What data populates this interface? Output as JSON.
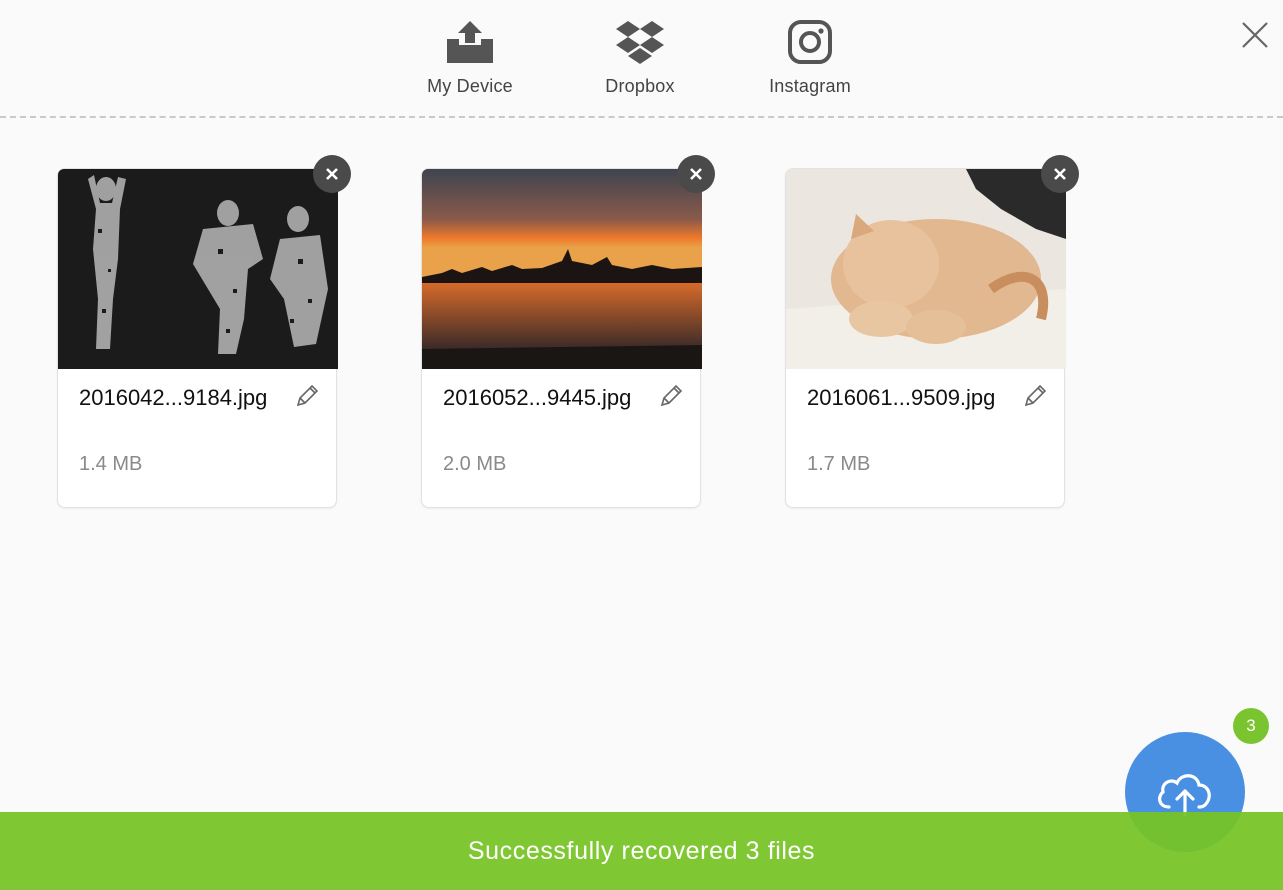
{
  "sources": [
    {
      "label": "My Device",
      "icon": "upload-tray-icon"
    },
    {
      "label": "Dropbox",
      "icon": "dropbox-icon"
    },
    {
      "label": "Instagram",
      "icon": "instagram-icon"
    }
  ],
  "close_icon": "close-icon",
  "files": [
    {
      "name": "2016042...9184.jpg",
      "size": "1.4 MB",
      "thumb": "dancers-photo"
    },
    {
      "name": "2016052...9445.jpg",
      "size": "2.0 MB",
      "thumb": "sunset-skyline-photo"
    },
    {
      "name": "2016061...9509.jpg",
      "size": "1.7 MB",
      "thumb": "sleeping-cat-photo"
    }
  ],
  "upload": {
    "count": "3",
    "icon": "cloud-upload-icon"
  },
  "toast": {
    "message": "Successfully recovered 3 files"
  },
  "colors": {
    "accent": "#4a90e2",
    "success": "#7ac52f",
    "remove": "#4a4a4a"
  }
}
